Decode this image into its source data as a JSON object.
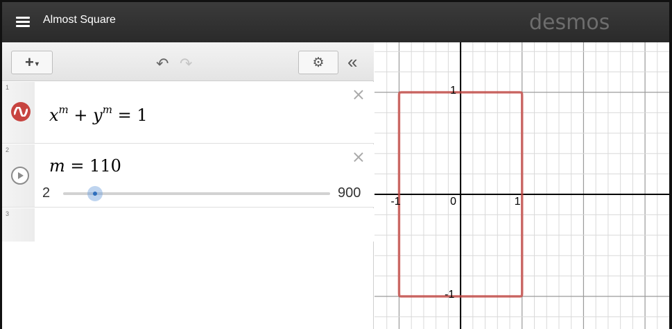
{
  "header": {
    "menu_icon": "hamburger-menu-icon",
    "title": "Almost Square",
    "brand": "desmos"
  },
  "toolbar": {
    "add_label": "+",
    "add_caret": "▾",
    "undo_glyph": "↶",
    "redo_glyph": "↷",
    "settings_glyph": "⚙",
    "collapse_glyph": "«"
  },
  "expressions": [
    {
      "number": "1",
      "icon": "graph-curve-icon",
      "color": "#c74440",
      "formula": {
        "base1": "x",
        "exp1": "m",
        "plus": " + ",
        "base2": "y",
        "exp2": "m",
        "rhs": " = 1"
      }
    },
    {
      "number": "2",
      "icon": "play-icon",
      "formula": {
        "lhs": "m",
        "rhs": " = 110"
      },
      "slider": {
        "min": "2",
        "max": "900",
        "value": 110
      }
    },
    {
      "number": "3"
    }
  ],
  "delete_glyph": "×",
  "graph": {
    "x_range": [
      -1.4,
      3.45
    ],
    "y_range": [
      -1.34,
      1.49
    ],
    "grid_step": 0.2,
    "axis_tick_labels": {
      "x_neg": "-1",
      "origin": "0",
      "x_pos": "1",
      "y_pos": "1",
      "y_neg": "-1"
    },
    "curve": {
      "type": "superellipse",
      "exponent": 110,
      "color": "#c74440"
    }
  }
}
